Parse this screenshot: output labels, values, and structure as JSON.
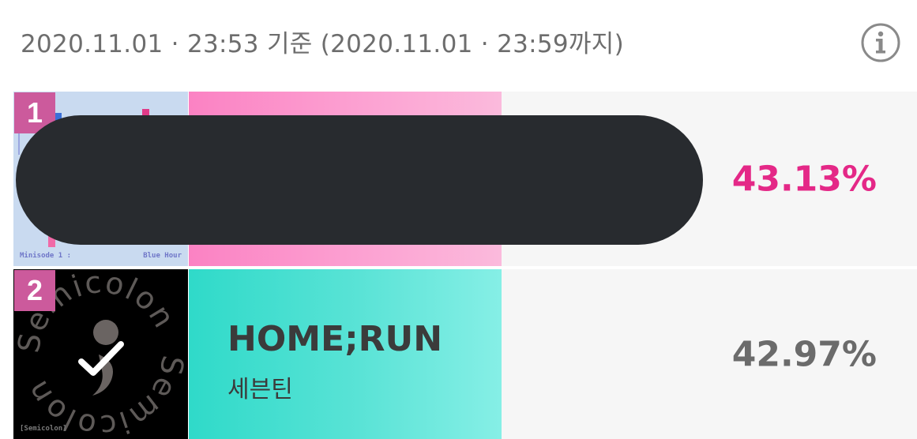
{
  "header": {
    "timestamp": "2020.11.01 · 23:53 기준 (2020.11.01 · 23:59까지)",
    "info_icon": "info-icon"
  },
  "rankings": [
    {
      "rank": "1",
      "percent": "43.13%",
      "album_caption_left": "Minisode 1 :",
      "album_caption_right": "Blue Hour",
      "band_color": "#fb82c3",
      "percent_color": "#e42887"
    },
    {
      "rank": "2",
      "title": "HOME;RUN",
      "artist": "세븐틴",
      "percent": "42.97%",
      "album_ring_text": "Semicolon",
      "album_caption": "[Semicolon]",
      "band_color": "#2fdac9",
      "percent_color": "#6b6b6b"
    }
  ]
}
